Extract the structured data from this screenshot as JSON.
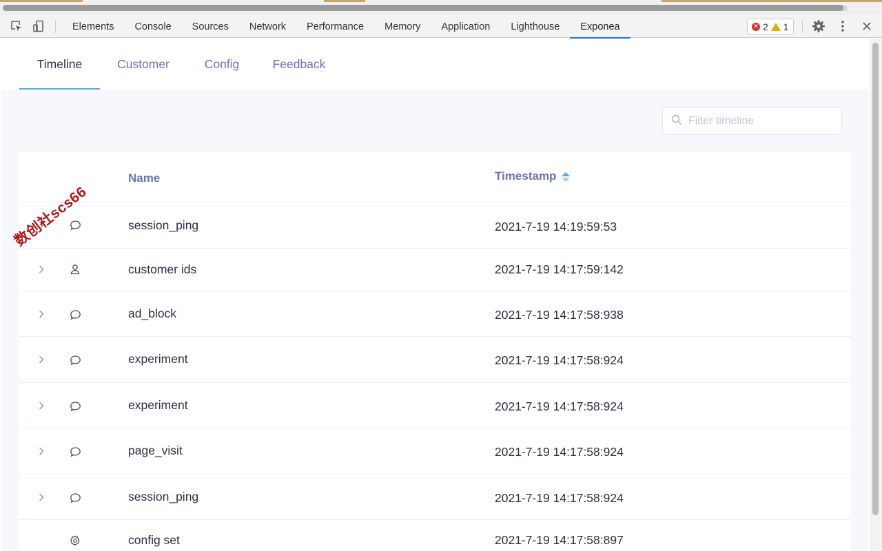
{
  "devtools": {
    "tabs": [
      "Elements",
      "Console",
      "Sources",
      "Network",
      "Performance",
      "Memory",
      "Application",
      "Lighthouse",
      "Exponea"
    ],
    "active_tab": "Exponea",
    "error_count": "2",
    "warning_count": "1",
    "icons": [
      "inspect-element-icon",
      "device-toggle-icon",
      "gear-icon",
      "more-vertical-icon",
      "close-icon"
    ]
  },
  "panel": {
    "tabs": [
      "Timeline",
      "Customer",
      "Config",
      "Feedback"
    ],
    "active_tab": "Timeline",
    "filter_placeholder": "Filter timeline",
    "accent_color": "#5aa9ea",
    "link_color": "#6b72b3"
  },
  "table": {
    "columns": {
      "name": "Name",
      "timestamp": "Timestamp"
    },
    "rows": [
      {
        "name": "session_ping",
        "timestamp": "2021-7-19 14:19:59:53",
        "icon": "chat-bubble-icon",
        "expandable": true
      },
      {
        "name": "customer ids",
        "timestamp": "2021-7-19 14:17:59:142",
        "icon": "user-icon",
        "expandable": true
      },
      {
        "name": "ad_block",
        "timestamp": "2021-7-19 14:17:58:938",
        "icon": "chat-bubble-icon",
        "expandable": true
      },
      {
        "name": "experiment",
        "timestamp": "2021-7-19 14:17:58:924",
        "icon": "chat-bubble-icon",
        "expandable": true
      },
      {
        "name": "experiment",
        "timestamp": "2021-7-19 14:17:58:924",
        "icon": "chat-bubble-icon",
        "expandable": true
      },
      {
        "name": "page_visit",
        "timestamp": "2021-7-19 14:17:58:924",
        "icon": "chat-bubble-icon",
        "expandable": true
      },
      {
        "name": "session_ping",
        "timestamp": "2021-7-19 14:17:58:924",
        "icon": "chat-bubble-icon",
        "expandable": true
      },
      {
        "name": "config set",
        "timestamp": "2021-7-19 14:17:58:897",
        "icon": "gear-icon",
        "expandable": false
      }
    ]
  },
  "watermark": "数创社scs66"
}
